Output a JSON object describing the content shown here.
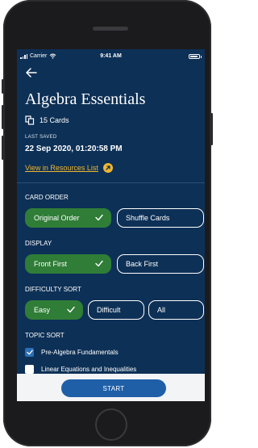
{
  "status_bar": {
    "carrier": "Carrier",
    "time": "9:41 AM"
  },
  "title": "Algebra Essentials",
  "card_count": "15 Cards",
  "last_saved": {
    "label": "LAST SAVED",
    "value": "22 Sep 2020, 01:20:58 PM"
  },
  "resources_link": "View in Resources List",
  "card_order": {
    "label": "CARD ORDER",
    "options": [
      {
        "label": "Original Order",
        "selected": true
      },
      {
        "label": "Shuffle Cards",
        "selected": false
      }
    ]
  },
  "display": {
    "label": "DISPLAY",
    "options": [
      {
        "label": "Front First",
        "selected": true
      },
      {
        "label": "Back First",
        "selected": false
      }
    ]
  },
  "difficulty_sort": {
    "label": "DIFFICULTY SORT",
    "options": [
      {
        "label": "Easy",
        "selected": true
      },
      {
        "label": "Difficult",
        "selected": false
      },
      {
        "label": "All",
        "selected": false
      }
    ]
  },
  "topic_sort": {
    "label": "TOPIC SORT",
    "topics": [
      {
        "label": "Pre-Algebra Fundamentals",
        "checked": true
      },
      {
        "label": "Linear Equations and Inequalities",
        "checked": false
      }
    ]
  },
  "start_label": "START",
  "colors": {
    "screen_bg": "#0d3056",
    "selected_green": "#2f7d37",
    "link_yellow": "#f1b730",
    "start_blue": "#1f5fa8",
    "checkbox_blue": "#2b6fb6"
  },
  "icons": {
    "back": "arrow-left-icon",
    "cards": "cards-icon",
    "external": "arrow-up-right-icon",
    "check": "check-icon"
  }
}
